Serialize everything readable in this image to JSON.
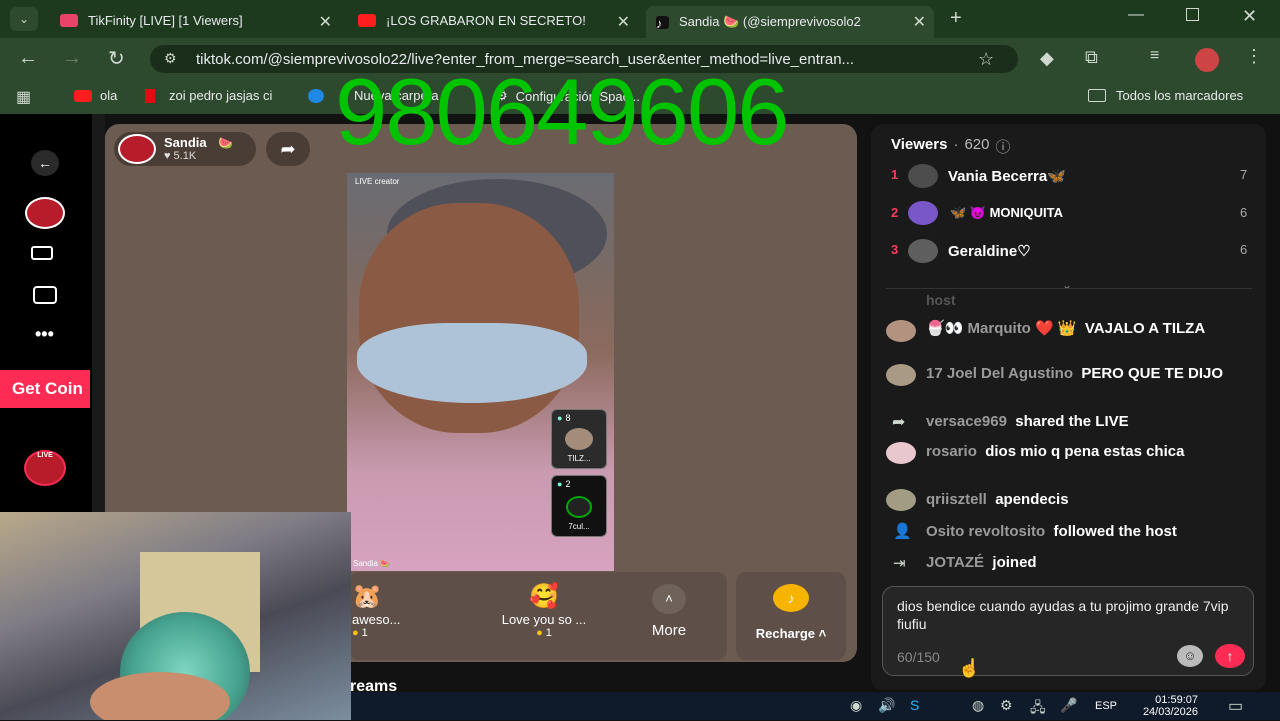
{
  "browser": {
    "tabs": [
      {
        "label": "TikFinity [LIVE] [1 Viewers]",
        "active": false
      },
      {
        "label": "¡LOS GRABARON EN SECRETO!",
        "active": false
      },
      {
        "label": "Sandia 🍉 (@siemprevivosolo2",
        "active": true
      }
    ],
    "url": "tiktok.com/@siemprevivosolo22/live?enter_from_merge=search_user&enter_method=live_entran...",
    "bookmarks": [
      "ola",
      "zoi pedro jasjas ci",
      "Nueva carpeta",
      "Configuración Spac..."
    ],
    "all_bookmarks": "Todos los marcadores"
  },
  "overlay_number": "980649606",
  "sidebar": {
    "get_coins": "Get Coin",
    "live_badge": "LIVE"
  },
  "host": {
    "name": "Sandia",
    "likes": "5.1K",
    "video_label": "LIVE creator",
    "video_footer": "Sandia"
  },
  "pk_thumbs": [
    {
      "count": "8",
      "label": "TILZ..."
    },
    {
      "count": "2",
      "label": "7cul..."
    }
  ],
  "gifts": [
    {
      "name": "aweso...",
      "price": "1"
    },
    {
      "name": "Love you so ...",
      "price": "1"
    }
  ],
  "more_label": "More",
  "recharge_label": "Recharge",
  "viewers": {
    "header": "Viewers",
    "count": "620",
    "top": [
      {
        "rank": "1",
        "name": "Vania Becerra🦋",
        "score": "7"
      },
      {
        "rank": "2",
        "name": "🦋 😈 MONIQUITA",
        "score": "6"
      },
      {
        "rank": "3",
        "name": "Geraldine♡",
        "score": "6"
      }
    ]
  },
  "chat": {
    "faded": "host",
    "messages": [
      {
        "user": "🍧👀 Marquito ❤️ 👑",
        "text": "VAJALO A TILZA"
      },
      {
        "user": "17 Joel Del Agustino",
        "text": "PERO QUE TE DIJO"
      },
      {
        "user": "versace969",
        "text": "shared the LIVE"
      },
      {
        "user": "rosario",
        "text": "dios mio q pena estas chica"
      },
      {
        "user": "qriisztell",
        "text": "apendecis"
      },
      {
        "user": "Osito revoltosito",
        "text": "followed the host"
      },
      {
        "user": "JOTAZÉ",
        "text": "joined"
      }
    ],
    "input_text": "dios bendice cuando ayudas a tu projimo grande 7vip fiufiu",
    "char_count": "60/150"
  },
  "partial_text": "reams",
  "taskbar": {
    "lang": "ESP",
    "time": "01:59:07",
    "date": "24/03/2026"
  }
}
